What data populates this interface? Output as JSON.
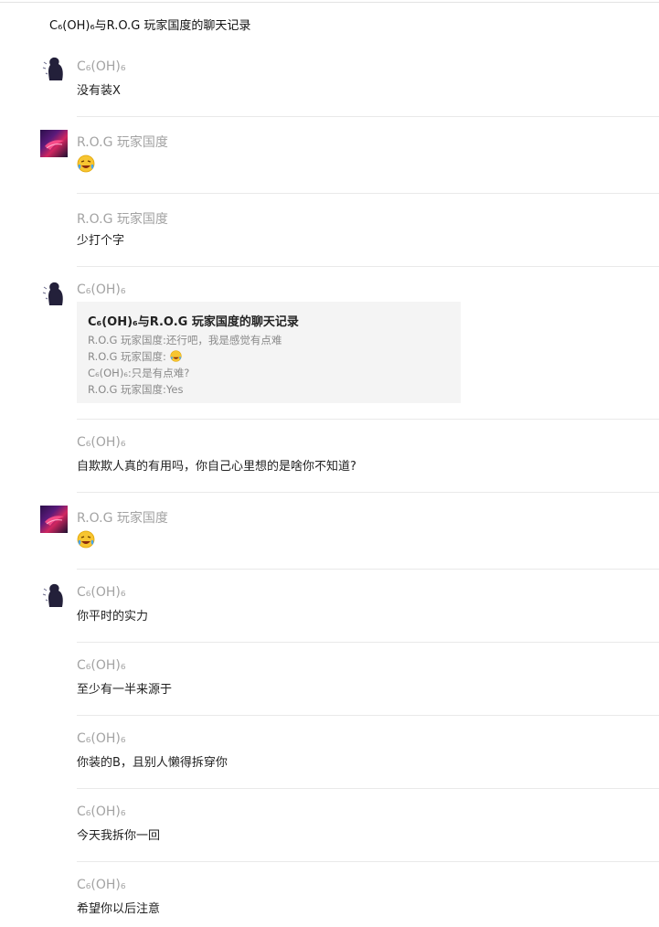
{
  "title": "C₆(OH)₆与R.O.G 玩家国度的聊天记录",
  "colors": {
    "sender": "#a3a3a3",
    "quote_bg": "#f4f4f4",
    "separator": "#e9e9e9"
  },
  "messages": [
    {
      "sender": "C₆(OH)₆",
      "text": "没有装X",
      "avatar": "c6-avatar"
    },
    {
      "sender": "R.O.G 玩家国度",
      "text": "",
      "emoji": "laughing-crying-emoji",
      "avatar": "rog-avatar"
    },
    {
      "sender": "R.O.G 玩家国度",
      "text": "少打个字"
    },
    {
      "sender": "C₆(OH)₆",
      "avatar": "c6-avatar",
      "quote": {
        "title": "C₆(OH)₆与R.O.G 玩家国度的聊天记录",
        "lines": [
          "R.O.G 玩家国度:还行吧，我是感觉有点难",
          "R.O.G 玩家国度:",
          "C₆(OH)₆:只是有点难?",
          "R.O.G 玩家国度:Yes"
        ]
      }
    },
    {
      "sender": "C₆(OH)₆",
      "text": "自欺欺人真的有用吗，你自己心里想的是啥你不知道?"
    },
    {
      "sender": "R.O.G 玩家国度",
      "text": "",
      "emoji": "laughing-crying-emoji",
      "avatar": "rog-avatar"
    },
    {
      "sender": "C₆(OH)₆",
      "text": "你平时的实力",
      "avatar": "c6-avatar"
    },
    {
      "sender": "C₆(OH)₆",
      "text": "至少有一半来源于"
    },
    {
      "sender": "C₆(OH)₆",
      "text": "你装的B，且别人懒得拆穿你"
    },
    {
      "sender": "C₆(OH)₆",
      "text": "今天我拆你一回"
    },
    {
      "sender": "C₆(OH)₆",
      "text": "希望你以后注意"
    }
  ]
}
